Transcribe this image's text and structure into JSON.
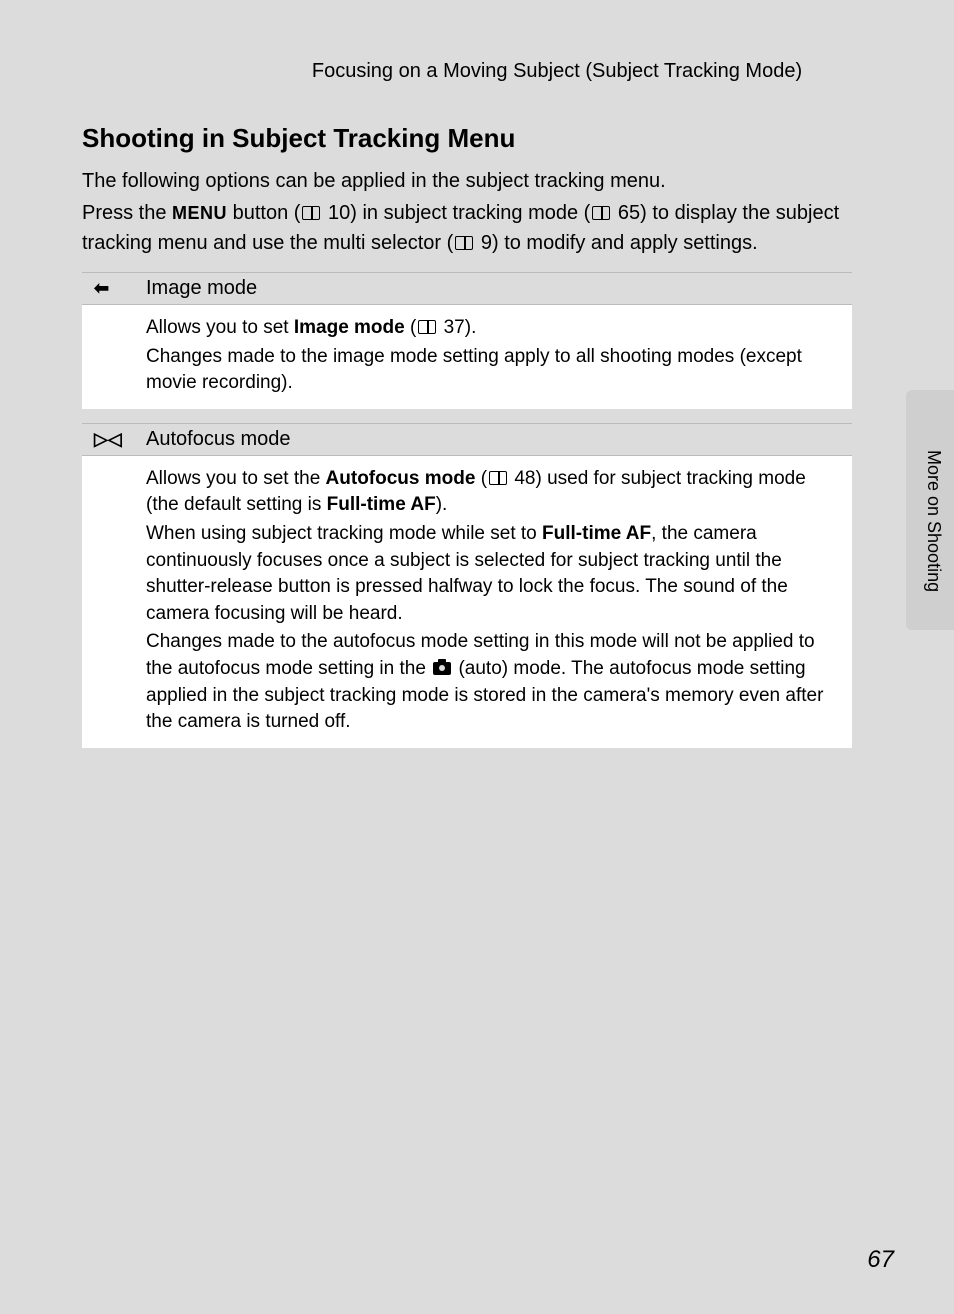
{
  "header": "Focusing on a Moving Subject (Subject Tracking Mode)",
  "title": "Shooting in Subject Tracking Menu",
  "intro1": "The following options can be applied in the subject tracking menu.",
  "intro2": {
    "a": "Press the ",
    "menu": "MENU",
    "b": " button (",
    "ref1": " 10) in subject tracking mode (",
    "ref2": " 65) to display the subject tracking menu and use the multi selector (",
    "ref3": " 9) to modify and apply settings."
  },
  "rows": [
    {
      "icon": "image-mode-icon",
      "glyph": "⬅",
      "label": "Image mode",
      "body": {
        "a": "Allows you to set ",
        "bold1": "Image mode",
        "b": " (",
        "ref": " 37).",
        "c": "Changes made to the image mode setting apply to all shooting modes (except movie recording)."
      }
    },
    {
      "icon": "autofocus-mode-icon",
      "glyph": "▷◁",
      "label": "Autofocus mode",
      "body": {
        "a": "Allows you to set the ",
        "bold1": "Autofocus mode",
        "b": " (",
        "ref": " 48) used for subject tracking mode (the default setting is ",
        "bold2": "Full-time AF",
        "c": ").",
        "d": "When using subject tracking mode while set to ",
        "bold3": "Full-time AF",
        "e": ", the camera continuously focuses once a subject is selected for subject tracking until the shutter-release button is pressed halfway to lock the focus. The sound of the camera focusing will be heard.",
        "f": "Changes made to the autofocus mode setting in this mode will not be applied to the autofocus mode setting in the ",
        "g": " (auto) mode. The autofocus mode setting applied in the subject tracking mode is stored in the camera's memory even after the camera is turned off."
      }
    }
  ],
  "side": "More on Shooting",
  "pagenum": "67"
}
